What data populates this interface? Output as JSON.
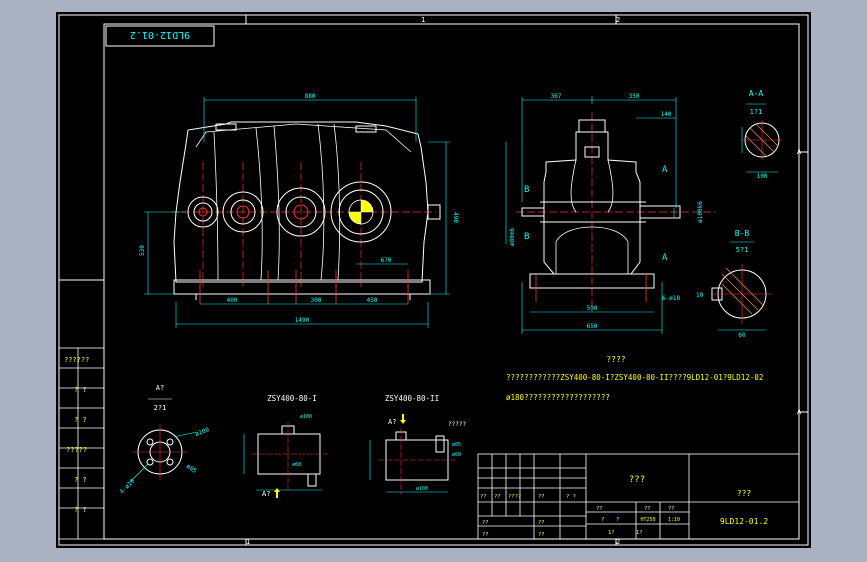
{
  "drawing": {
    "title_box_text": "9LD12-01.2",
    "border_marks": {
      "top": [
        "1",
        "2"
      ],
      "bottom": [
        "1",
        "2"
      ],
      "right": [
        "A",
        "A"
      ]
    },
    "main_dims": {
      "top_span": "880",
      "height": "490",
      "center_height": "530",
      "center_label": "670",
      "spans": [
        "400",
        "300",
        "450"
      ],
      "base_total": "1490"
    },
    "side_dims": {
      "left_span": "367",
      "right_span": "350",
      "shaft": "140",
      "base": "590",
      "total": "650",
      "small_shaft": "ø100k6",
      "left_shaft": "ø80m6",
      "keyway": "6-ø18"
    },
    "section_labels": {
      "a_a": "A-A",
      "a_a_scale": "1?1",
      "b_b": "B-B",
      "b_b_scale": "5?1",
      "a_a_dim": "100",
      "b_b_dim": "60",
      "b_b_side": "10"
    },
    "view_letters": {
      "b": "B",
      "a": "A"
    },
    "tech_title": "????",
    "tech_line1": "????????????ZSY400-80-I?ZSY400-80-II????9LD12-01?9LD12-02",
    "tech_line2": "ø180???????????????????",
    "left_table": [
      "??????",
      "? ?",
      "? ?",
      "?????",
      "? ?",
      "? ?"
    ],
    "small_views": {
      "a_label": "A?",
      "a_scale": "2?1",
      "view1_title": "ZSY400-80-I",
      "view2_title": "ZSY400-80-II",
      "arrow_label": "A?",
      "note": "?????",
      "d1": "ø100",
      "d2": "ø60",
      "d3": "ø85",
      "d4": "4-ø18"
    },
    "title_block": {
      "part_name": "???",
      "company": "???",
      "drawing_no": "9LD12-01.2",
      "material": "HT250",
      "scale_value": "1:10",
      "qty": "1",
      "sheet": "1",
      "cells": [
        "??",
        "??",
        "????",
        "??",
        "? ?",
        "??",
        "??",
        "??",
        "?",
        "?",
        "??",
        "??",
        "??",
        "??",
        "1?",
        "1?"
      ]
    }
  }
}
